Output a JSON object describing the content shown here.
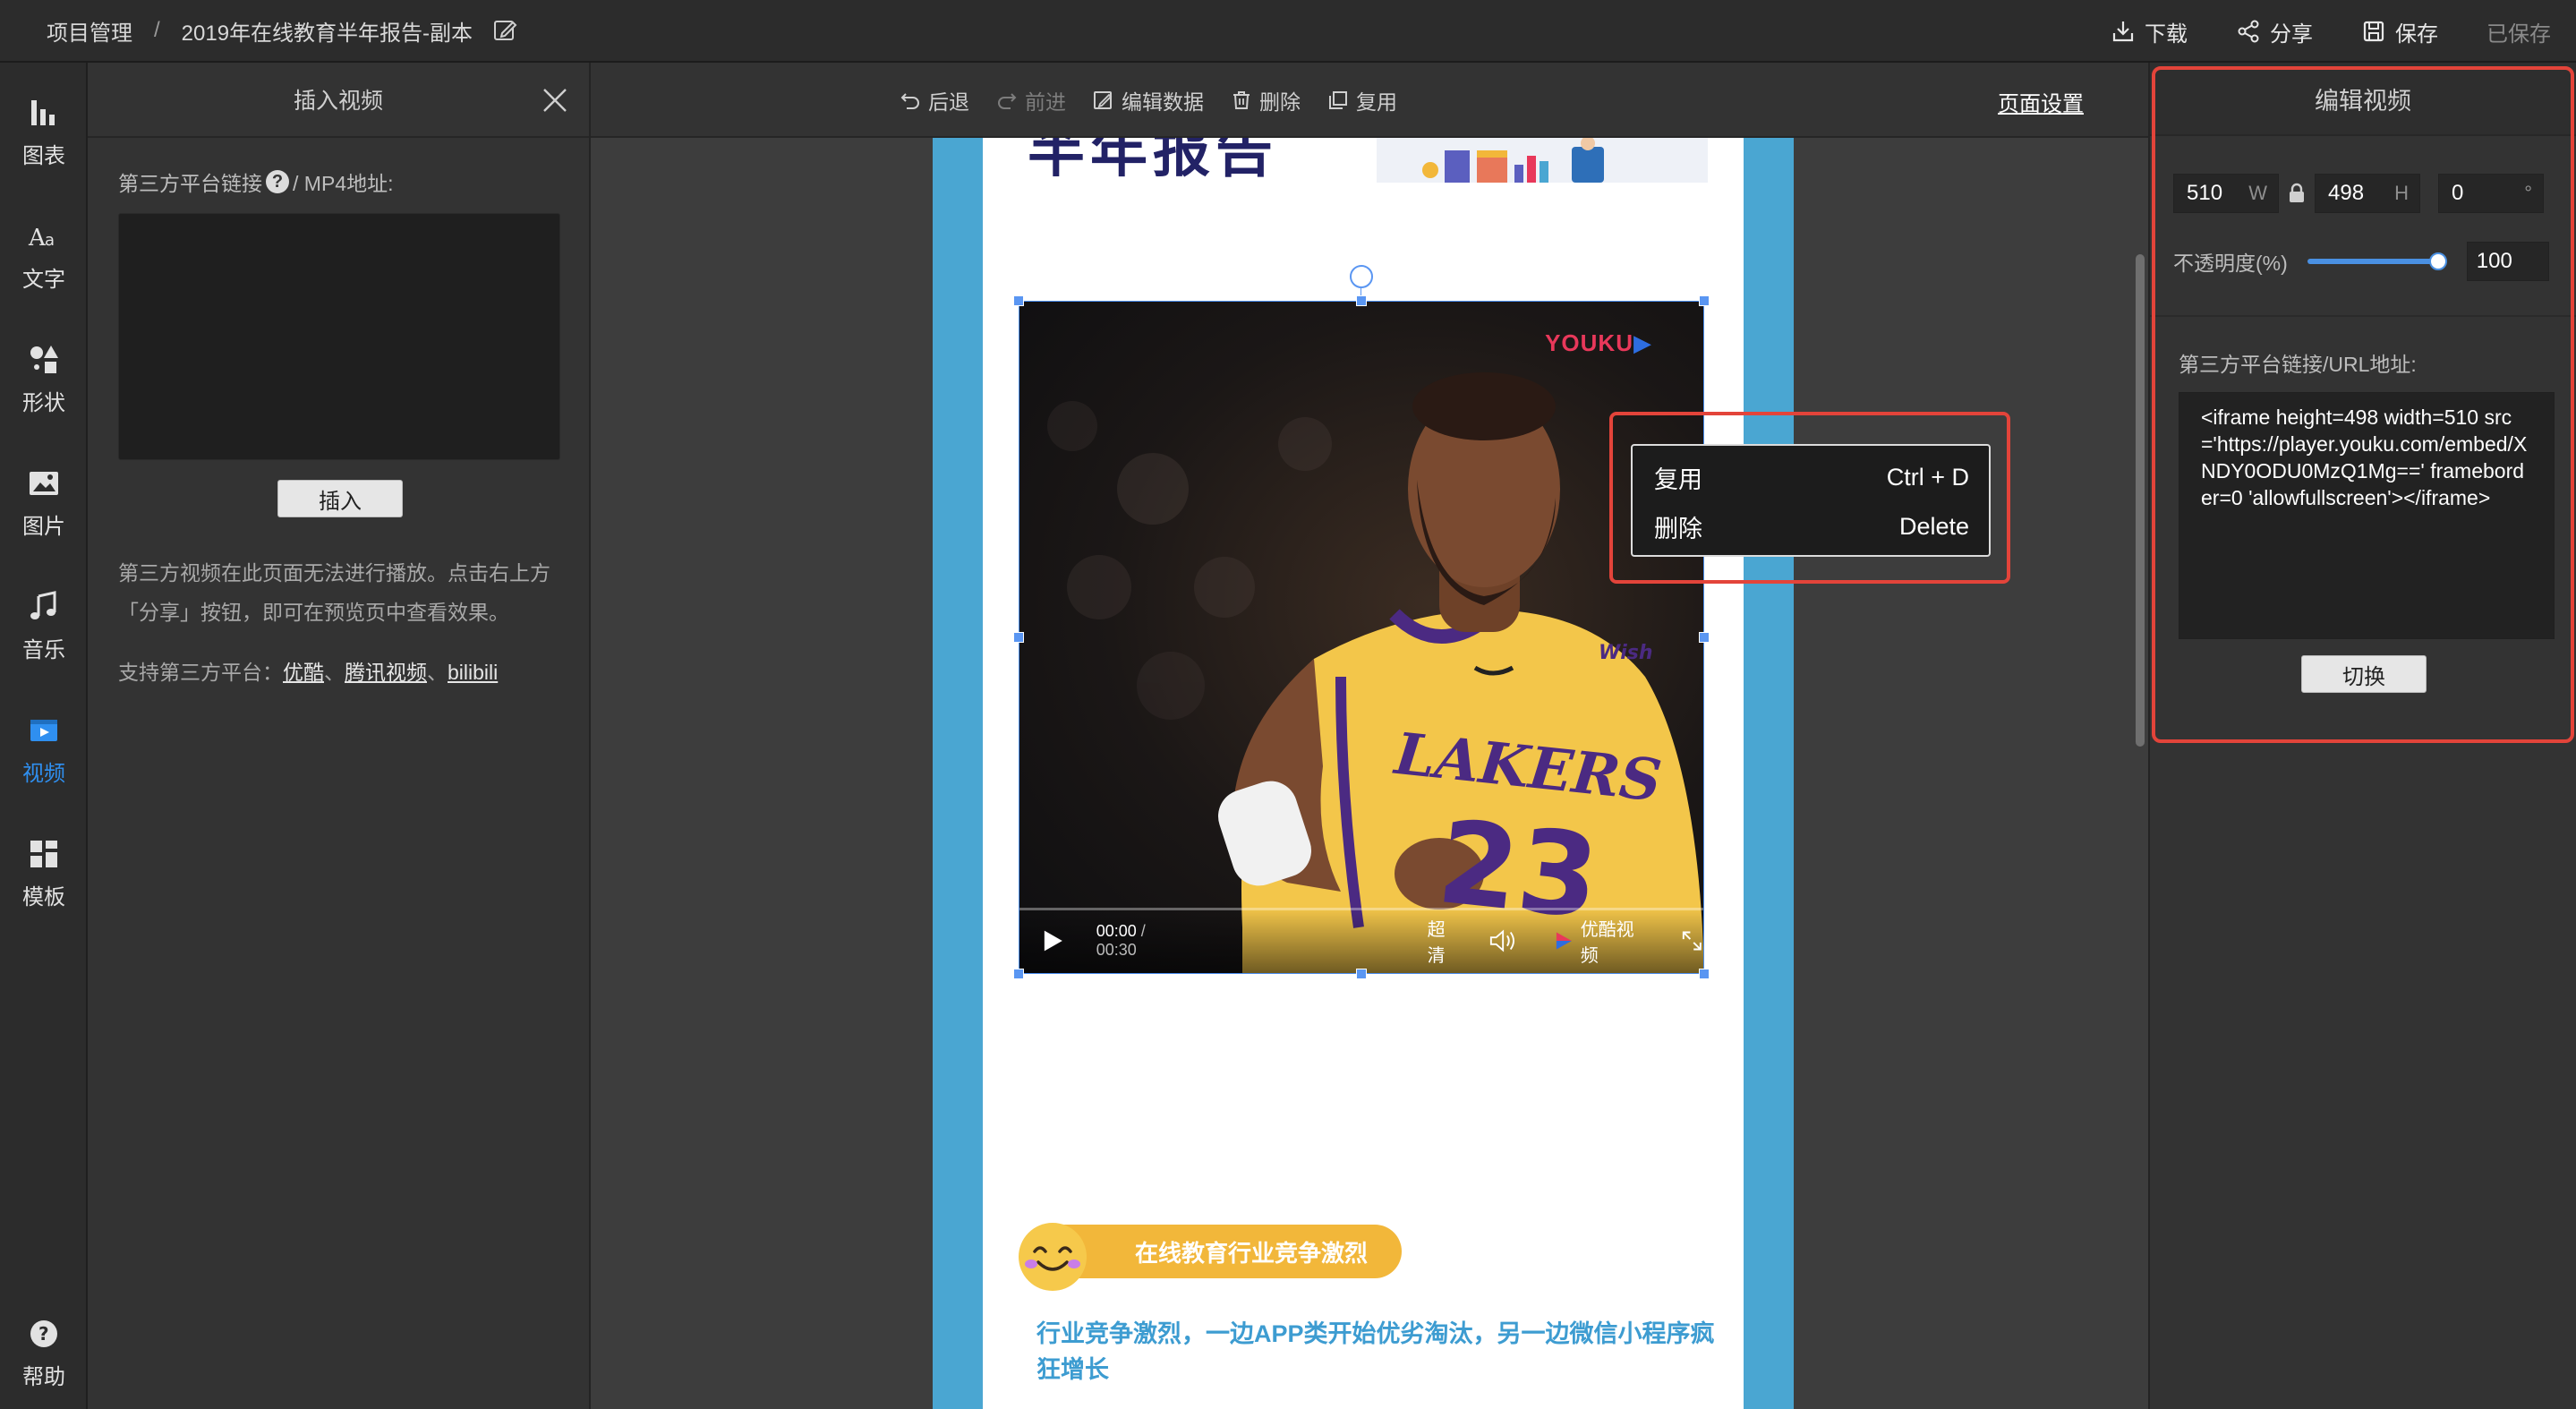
{
  "header": {
    "project": "项目管理",
    "separator": "/",
    "doc_title": "2019年在线教育半年报告-副本",
    "actions": {
      "download": "下载",
      "share": "分享",
      "save": "保存",
      "saved_status": "已保存"
    }
  },
  "rail": {
    "items": [
      {
        "label": "图表",
        "icon": "bar-chart-icon"
      },
      {
        "label": "文字",
        "icon": "text-icon"
      },
      {
        "label": "形状",
        "icon": "shapes-icon"
      },
      {
        "label": "图片",
        "icon": "image-icon"
      },
      {
        "label": "音乐",
        "icon": "music-icon"
      },
      {
        "label": "视频",
        "icon": "video-icon",
        "active": true
      },
      {
        "label": "模板",
        "icon": "template-icon"
      }
    ],
    "help": "帮助"
  },
  "insert_panel": {
    "title": "插入视频",
    "link_label_a": "第三方平台链接",
    "link_label_b": "/ MP4地址:",
    "textarea_value": "",
    "insert_button": "插入",
    "note": "第三方视频在此页面无法进行播放。点击右上方「分享」按钮，即可在预览页中查看效果。",
    "platforms_prefix": "支持第三方平台：",
    "platforms": [
      "优酷",
      "腾讯视频",
      "bilibili"
    ],
    "platform_sep": "、"
  },
  "toolbar": {
    "undo": "后退",
    "redo": "前进",
    "edit_data": "编辑数据",
    "delete": "删除",
    "duplicate": "复用",
    "page_settings": "页面设置"
  },
  "canvas": {
    "title_fragment": "半年报告",
    "video": {
      "watermark": "YOUKU",
      "time_current": "00:00",
      "time_total": "/ 00:30",
      "quality": "超清",
      "brand": "优酷视频",
      "progress": 0,
      "jersey_team": "LAKERS",
      "jersey_number": "23",
      "jersey_sponsor": "Wish"
    },
    "section_badge": "在线教育行业竞争激烈",
    "body_text": "行业竞争激烈，一边APP类开始优劣淘汰，另一边微信小程序疯狂增长"
  },
  "context_menu": {
    "items": [
      {
        "label": "复用",
        "shortcut": "Ctrl + D"
      },
      {
        "label": "删除",
        "shortcut": "Delete"
      }
    ]
  },
  "right_panel": {
    "title": "编辑视频",
    "width": "510",
    "width_unit": "W",
    "height": "498",
    "height_unit": "H",
    "rotation": "0",
    "rotation_unit": "°",
    "opacity_label": "不透明度(%)",
    "opacity": "100",
    "opacity_fraction": 1.0,
    "url_label": "第三方平台链接/URL地址:",
    "url_value": "<iframe height=498 width=510 src='https://player.youku.com/embed/XNDY0ODU0MzQ1Mg==' frameborder=0 'allowfullscreen'></iframe>",
    "switch_button": "切换"
  },
  "colors": {
    "accent": "#2f8ff0",
    "highlight_red": "#e3443a",
    "poster_blue": "#4aa6d2",
    "badge_yellow": "#f2b73a",
    "youku_red": "#e8385a"
  }
}
